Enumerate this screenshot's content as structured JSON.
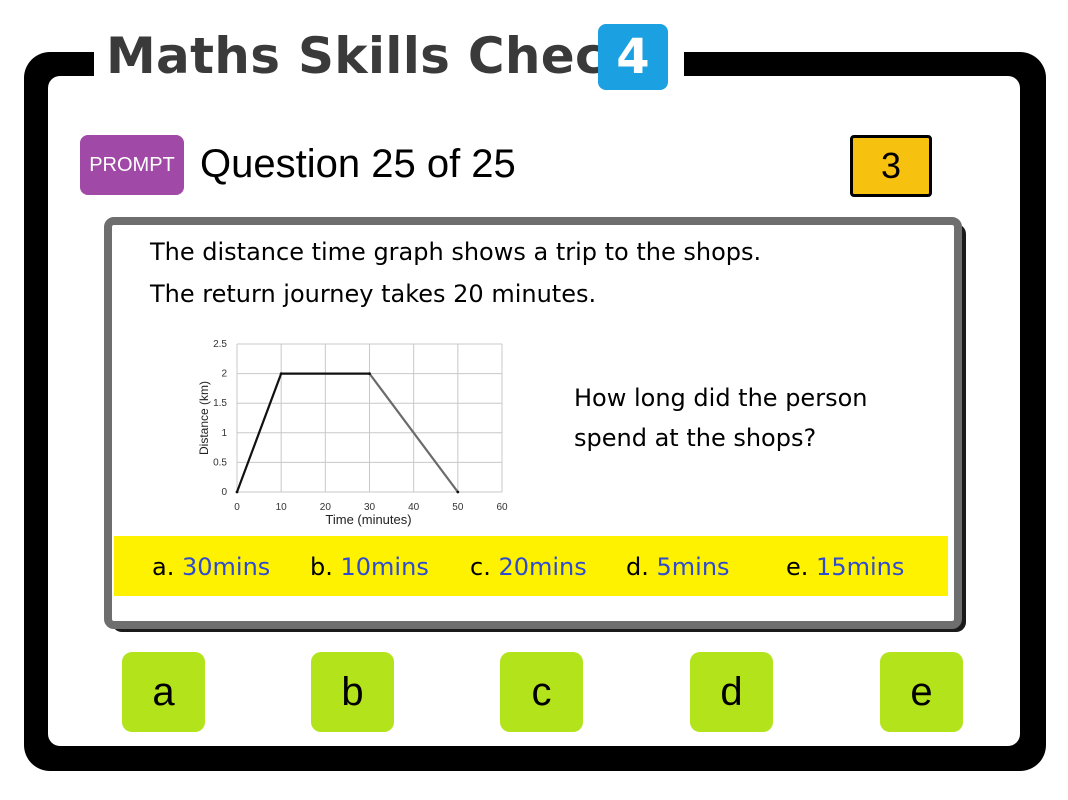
{
  "header": {
    "title": "Maths Skills Check",
    "level": "4"
  },
  "toolbar": {
    "prompt_label": "PROMPT",
    "question_counter": "Question 25 of 25",
    "score": "3"
  },
  "question": {
    "line1": "The distance time graph shows a trip to the shops.",
    "line2": "The return journey takes 20 minutes.",
    "ask_line1": "How long did the person",
    "ask_line2": "spend at the shops?"
  },
  "options": [
    {
      "letter": "a.",
      "value": "30mins"
    },
    {
      "letter": "b.",
      "value": "10mins"
    },
    {
      "letter": "c.",
      "value": "20mins"
    },
    {
      "letter": "d.",
      "value": "5mins"
    },
    {
      "letter": "e.",
      "value": "15mins"
    }
  ],
  "choices": [
    "a",
    "b",
    "c",
    "d",
    "e"
  ],
  "chart_data": {
    "type": "line",
    "title": "",
    "xlabel": "Time (minutes)",
    "ylabel": "Distance (km)",
    "xlim": [
      0,
      60
    ],
    "ylim": [
      0,
      2.5
    ],
    "x_ticks": [
      "0",
      "10",
      "20",
      "30",
      "40",
      "50",
      "60"
    ],
    "y_ticks": [
      "0",
      "0.5",
      "1",
      "1.5",
      "2",
      "2.5"
    ],
    "grid": true,
    "series": [
      {
        "x": [
          0,
          10,
          30,
          50
        ],
        "y": [
          0,
          2,
          2,
          0
        ]
      }
    ]
  },
  "colors": {
    "level_badge": "#1ba0e2",
    "prompt_button": "#a049a6",
    "score_badge": "#f7c10f",
    "answers_bar": "#fff200",
    "answer_value": "#2f4bd0",
    "choice_button": "#b3e31b"
  }
}
